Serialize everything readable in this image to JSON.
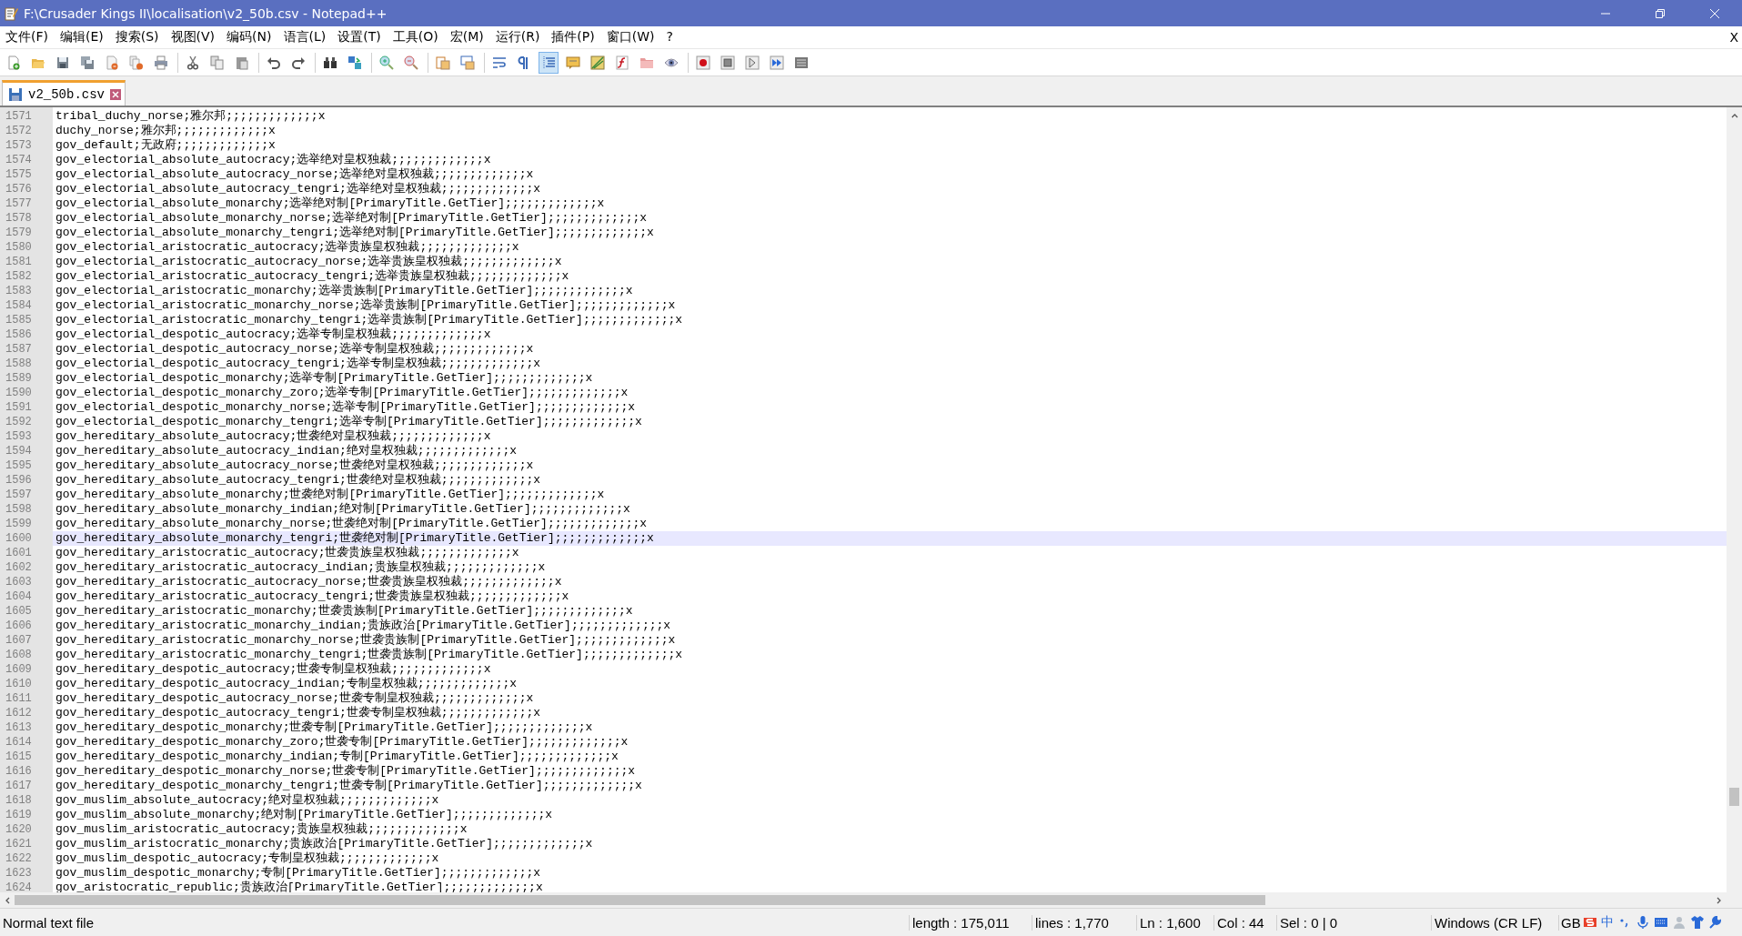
{
  "window": {
    "title": "F:\\Crusader Kings II\\localisation\\v2_50b.csv - Notepad++"
  },
  "menu": [
    "文件(F)",
    "编辑(E)",
    "搜索(S)",
    "视图(V)",
    "编码(N)",
    "语言(L)",
    "设置(T)",
    "工具(O)",
    "宏(M)",
    "运行(R)",
    "插件(P)",
    "窗口(W)",
    "?"
  ],
  "menu_close": "X",
  "toolbar": [
    {
      "kind": "new",
      "pressed": false
    },
    {
      "kind": "open",
      "pressed": false
    },
    {
      "kind": "save",
      "pressed": false
    },
    {
      "kind": "saveall",
      "pressed": false
    },
    {
      "kind": "close",
      "pressed": false
    },
    {
      "kind": "closeall",
      "pressed": false
    },
    {
      "kind": "print",
      "pressed": false
    },
    {
      "kind": "sep"
    },
    {
      "kind": "cut",
      "pressed": false
    },
    {
      "kind": "copy",
      "pressed": false
    },
    {
      "kind": "paste",
      "pressed": false
    },
    {
      "kind": "sep"
    },
    {
      "kind": "undo",
      "pressed": false
    },
    {
      "kind": "redo",
      "pressed": false
    },
    {
      "kind": "sep"
    },
    {
      "kind": "find",
      "pressed": false
    },
    {
      "kind": "replace",
      "pressed": false
    },
    {
      "kind": "sep"
    },
    {
      "kind": "zoomin",
      "pressed": false
    },
    {
      "kind": "zoomout",
      "pressed": false
    },
    {
      "kind": "sep"
    },
    {
      "kind": "syncv",
      "pressed": false
    },
    {
      "kind": "synch",
      "pressed": false
    },
    {
      "kind": "sep"
    },
    {
      "kind": "wrap",
      "pressed": false
    },
    {
      "kind": "pilcrow",
      "pressed": false
    },
    {
      "kind": "indent",
      "pressed": true
    },
    {
      "kind": "lang",
      "pressed": false
    },
    {
      "kind": "map",
      "pressed": false
    },
    {
      "kind": "func",
      "pressed": false
    },
    {
      "kind": "folder",
      "pressed": false
    },
    {
      "kind": "eye",
      "pressed": false
    },
    {
      "kind": "sep"
    },
    {
      "kind": "record",
      "pressed": false
    },
    {
      "kind": "stop",
      "pressed": false
    },
    {
      "kind": "play",
      "pressed": false
    },
    {
      "kind": "playmulti",
      "pressed": false
    },
    {
      "kind": "savemacro",
      "pressed": false
    }
  ],
  "tabs": [
    {
      "label": "v2_50b.csv",
      "selected": true,
      "saved": true
    }
  ],
  "lines": [
    {
      "number": "1571",
      "text": "tribal_duchy_norse;雅尔邦;;;;;;;;;;;;;x",
      "current": false
    },
    {
      "number": "1572",
      "text": "duchy_norse;雅尔邦;;;;;;;;;;;;;x",
      "current": false
    },
    {
      "number": "1573",
      "text": "gov_default;无政府;;;;;;;;;;;;;x",
      "current": false
    },
    {
      "number": "1574",
      "text": "gov_electorial_absolute_autocracy;选举绝对皇权独裁;;;;;;;;;;;;;x",
      "current": false
    },
    {
      "number": "1575",
      "text": "gov_electorial_absolute_autocracy_norse;选举绝对皇权独裁;;;;;;;;;;;;;x",
      "current": false
    },
    {
      "number": "1576",
      "text": "gov_electorial_absolute_autocracy_tengri;选举绝对皇权独裁;;;;;;;;;;;;;x",
      "current": false
    },
    {
      "number": "1577",
      "text": "gov_electorial_absolute_monarchy;选举绝对制[PrimaryTitle.GetTier];;;;;;;;;;;;;x",
      "current": false
    },
    {
      "number": "1578",
      "text": "gov_electorial_absolute_monarchy_norse;选举绝对制[PrimaryTitle.GetTier];;;;;;;;;;;;;x",
      "current": false
    },
    {
      "number": "1579",
      "text": "gov_electorial_absolute_monarchy_tengri;选举绝对制[PrimaryTitle.GetTier];;;;;;;;;;;;;x",
      "current": false
    },
    {
      "number": "1580",
      "text": "gov_electorial_aristocratic_autocracy;选举贵族皇权独裁;;;;;;;;;;;;;x",
      "current": false
    },
    {
      "number": "1581",
      "text": "gov_electorial_aristocratic_autocracy_norse;选举贵族皇权独裁;;;;;;;;;;;;;x",
      "current": false
    },
    {
      "number": "1582",
      "text": "gov_electorial_aristocratic_autocracy_tengri;选举贵族皇权独裁;;;;;;;;;;;;;x",
      "current": false
    },
    {
      "number": "1583",
      "text": "gov_electorial_aristocratic_monarchy;选举贵族制[PrimaryTitle.GetTier];;;;;;;;;;;;;x",
      "current": false
    },
    {
      "number": "1584",
      "text": "gov_electorial_aristocratic_monarchy_norse;选举贵族制[PrimaryTitle.GetTier];;;;;;;;;;;;;x",
      "current": false
    },
    {
      "number": "1585",
      "text": "gov_electorial_aristocratic_monarchy_tengri;选举贵族制[PrimaryTitle.GetTier];;;;;;;;;;;;;x",
      "current": false
    },
    {
      "number": "1586",
      "text": "gov_electorial_despotic_autocracy;选举专制皇权独裁;;;;;;;;;;;;;x",
      "current": false
    },
    {
      "number": "1587",
      "text": "gov_electorial_despotic_autocracy_norse;选举专制皇权独裁;;;;;;;;;;;;;x",
      "current": false
    },
    {
      "number": "1588",
      "text": "gov_electorial_despotic_autocracy_tengri;选举专制皇权独裁;;;;;;;;;;;;;x",
      "current": false
    },
    {
      "number": "1589",
      "text": "gov_electorial_despotic_monarchy;选举专制[PrimaryTitle.GetTier];;;;;;;;;;;;;x",
      "current": false
    },
    {
      "number": "1590",
      "text": "gov_electorial_despotic_monarchy_zoro;选举专制[PrimaryTitle.GetTier];;;;;;;;;;;;;x",
      "current": false
    },
    {
      "number": "1591",
      "text": "gov_electorial_despotic_monarchy_norse;选举专制[PrimaryTitle.GetTier];;;;;;;;;;;;;x",
      "current": false
    },
    {
      "number": "1592",
      "text": "gov_electorial_despotic_monarchy_tengri;选举专制[PrimaryTitle.GetTier];;;;;;;;;;;;;x",
      "current": false
    },
    {
      "number": "1593",
      "text": "gov_hereditary_absolute_autocracy;世袭绝对皇权独裁;;;;;;;;;;;;;x",
      "current": false
    },
    {
      "number": "1594",
      "text": "gov_hereditary_absolute_autocracy_indian;绝对皇权独裁;;;;;;;;;;;;;x",
      "current": false
    },
    {
      "number": "1595",
      "text": "gov_hereditary_absolute_autocracy_norse;世袭绝对皇权独裁;;;;;;;;;;;;;x",
      "current": false
    },
    {
      "number": "1596",
      "text": "gov_hereditary_absolute_autocracy_tengri;世袭绝对皇权独裁;;;;;;;;;;;;;x",
      "current": false
    },
    {
      "number": "1597",
      "text": "gov_hereditary_absolute_monarchy;世袭绝对制[PrimaryTitle.GetTier];;;;;;;;;;;;;x",
      "current": false
    },
    {
      "number": "1598",
      "text": "gov_hereditary_absolute_monarchy_indian;绝对制[PrimaryTitle.GetTier];;;;;;;;;;;;;x",
      "current": false
    },
    {
      "number": "1599",
      "text": "gov_hereditary_absolute_monarchy_norse;世袭绝对制[PrimaryTitle.GetTier];;;;;;;;;;;;;x",
      "current": false
    },
    {
      "number": "1600",
      "text": "gov_hereditary_absolute_monarchy_tengri;世袭绝对制[PrimaryTitle.GetTier];;;;;;;;;;;;;x",
      "current": true
    },
    {
      "number": "1601",
      "text": "gov_hereditary_aristocratic_autocracy;世袭贵族皇权独裁;;;;;;;;;;;;;x",
      "current": false
    },
    {
      "number": "1602",
      "text": "gov_hereditary_aristocratic_autocracy_indian;贵族皇权独裁;;;;;;;;;;;;;x",
      "current": false
    },
    {
      "number": "1603",
      "text": "gov_hereditary_aristocratic_autocracy_norse;世袭贵族皇权独裁;;;;;;;;;;;;;x",
      "current": false
    },
    {
      "number": "1604",
      "text": "gov_hereditary_aristocratic_autocracy_tengri;世袭贵族皇权独裁;;;;;;;;;;;;;x",
      "current": false
    },
    {
      "number": "1605",
      "text": "gov_hereditary_aristocratic_monarchy;世袭贵族制[PrimaryTitle.GetTier];;;;;;;;;;;;;x",
      "current": false
    },
    {
      "number": "1606",
      "text": "gov_hereditary_aristocratic_monarchy_indian;贵族政治[PrimaryTitle.GetTier];;;;;;;;;;;;;x",
      "current": false
    },
    {
      "number": "1607",
      "text": "gov_hereditary_aristocratic_monarchy_norse;世袭贵族制[PrimaryTitle.GetTier];;;;;;;;;;;;;x",
      "current": false
    },
    {
      "number": "1608",
      "text": "gov_hereditary_aristocratic_monarchy_tengri;世袭贵族制[PrimaryTitle.GetTier];;;;;;;;;;;;;x",
      "current": false
    },
    {
      "number": "1609",
      "text": "gov_hereditary_despotic_autocracy;世袭专制皇权独裁;;;;;;;;;;;;;x",
      "current": false
    },
    {
      "number": "1610",
      "text": "gov_hereditary_despotic_autocracy_indian;专制皇权独裁;;;;;;;;;;;;;x",
      "current": false
    },
    {
      "number": "1611",
      "text": "gov_hereditary_despotic_autocracy_norse;世袭专制皇权独裁;;;;;;;;;;;;;x",
      "current": false
    },
    {
      "number": "1612",
      "text": "gov_hereditary_despotic_autocracy_tengri;世袭专制皇权独裁;;;;;;;;;;;;;x",
      "current": false
    },
    {
      "number": "1613",
      "text": "gov_hereditary_despotic_monarchy;世袭专制[PrimaryTitle.GetTier];;;;;;;;;;;;;x",
      "current": false
    },
    {
      "number": "1614",
      "text": "gov_hereditary_despotic_monarchy_zoro;世袭专制[PrimaryTitle.GetTier];;;;;;;;;;;;;x",
      "current": false
    },
    {
      "number": "1615",
      "text": "gov_hereditary_despotic_monarchy_indian;专制[PrimaryTitle.GetTier];;;;;;;;;;;;;x",
      "current": false
    },
    {
      "number": "1616",
      "text": "gov_hereditary_despotic_monarchy_norse;世袭专制[PrimaryTitle.GetTier];;;;;;;;;;;;;x",
      "current": false
    },
    {
      "number": "1617",
      "text": "gov_hereditary_despotic_monarchy_tengri;世袭专制[PrimaryTitle.GetTier];;;;;;;;;;;;;x",
      "current": false
    },
    {
      "number": "1618",
      "text": "gov_muslim_absolute_autocracy;绝对皇权独裁;;;;;;;;;;;;;x",
      "current": false
    },
    {
      "number": "1619",
      "text": "gov_muslim_absolute_monarchy;绝对制[PrimaryTitle.GetTier];;;;;;;;;;;;;x",
      "current": false
    },
    {
      "number": "1620",
      "text": "gov_muslim_aristocratic_autocracy;贵族皇权独裁;;;;;;;;;;;;;x",
      "current": false
    },
    {
      "number": "1621",
      "text": "gov_muslim_aristocratic_monarchy;贵族政治[PrimaryTitle.GetTier];;;;;;;;;;;;;x",
      "current": false
    },
    {
      "number": "1622",
      "text": "gov_muslim_despotic_autocracy;专制皇权独裁;;;;;;;;;;;;;x",
      "current": false
    },
    {
      "number": "1623",
      "text": "gov_muslim_despotic_monarchy;专制[PrimaryTitle.GetTier];;;;;;;;;;;;;x",
      "current": false
    },
    {
      "number": "1624",
      "text": "gov_aristocratic_republic;贵族政治[PrimaryTitle.GetTier];;;;;;;;;;;;;x",
      "current": false
    }
  ],
  "status_bar": {
    "file_type": "Normal text file",
    "length": "length : 175,011",
    "lines": "lines : 1,770",
    "line": "Ln : 1,600",
    "column": "Col : 44",
    "selection": "Sel : 0 | 0",
    "eol": "Windows (CR LF)",
    "encoding": "GB",
    "ime": "中"
  }
}
